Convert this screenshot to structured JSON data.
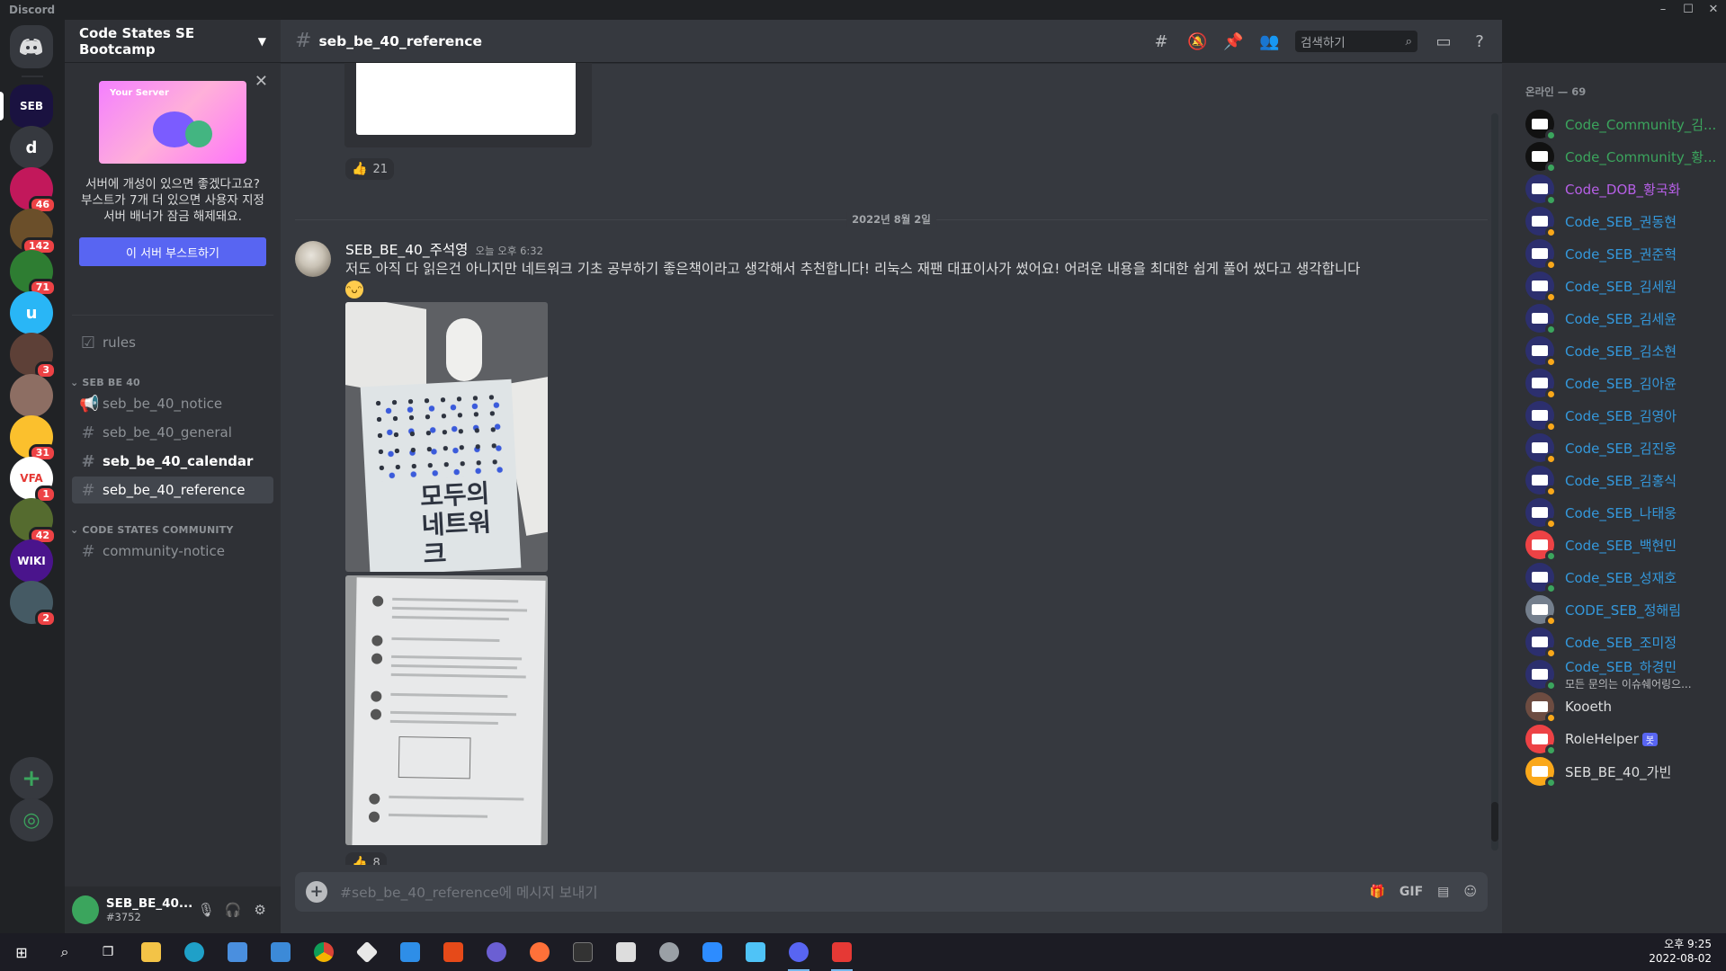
{
  "window": {
    "title": "Discord"
  },
  "rail": {
    "servers": [
      {
        "label": "SEB",
        "bg": "#1a1240",
        "badge": ""
      },
      {
        "label": "d",
        "bg": "#36393f",
        "badge": ""
      },
      {
        "label": "",
        "bg": "#c2185b",
        "badge": "46"
      },
      {
        "label": "",
        "bg": "#6b4f2a",
        "badge": "142"
      },
      {
        "label": "",
        "bg": "#2e7d32",
        "badge": "71"
      },
      {
        "label": "u",
        "bg": "#29b6f6",
        "badge": ""
      },
      {
        "label": "",
        "bg": "#5d4037",
        "badge": "3"
      },
      {
        "label": "",
        "bg": "#8d6e63",
        "badge": ""
      },
      {
        "label": "",
        "bg": "#fbc02d",
        "badge": "31"
      },
      {
        "label": "VFA",
        "bg": "#ffffff",
        "badge": "1"
      },
      {
        "label": "",
        "bg": "#556b2f",
        "badge": "42"
      },
      {
        "label": "WIKI",
        "bg": "#4a148c",
        "badge": ""
      },
      {
        "label": "",
        "bg": "#455a64",
        "badge": "2"
      }
    ]
  },
  "sidebar": {
    "server_name": "Code States SE Bootcamp",
    "boost": {
      "banner_label": "Your Server",
      "text": "서버에 개성이 있으면 좋겠다고요? 부스트가 7개 더 있으면 사용자 지정 서버 배너가 잠금 해제돼요.",
      "button": "이 서버 부스트하기"
    },
    "channels_top": [
      {
        "name": "rules"
      }
    ],
    "categories": [
      {
        "name": "SEB BE 40",
        "channels": [
          {
            "name": "seb_be_40_notice"
          },
          {
            "name": "seb_be_40_general"
          },
          {
            "name": "seb_be_40_calendar"
          },
          {
            "name": "seb_be_40_reference"
          }
        ]
      },
      {
        "name": "CODE STATES COMMUNITY",
        "channels": [
          {
            "name": "community-notice"
          }
        ]
      }
    ],
    "user": {
      "name": "SEB_BE_40...",
      "tag": "#3752"
    }
  },
  "header": {
    "channel": "seb_be_40_reference",
    "search_placeholder": "검색하기"
  },
  "messages": {
    "prev_reaction": {
      "emoji": "👍",
      "count": "21"
    },
    "date_divider": "2022년 8월 2일",
    "author": "SEB_BE_40_주석영",
    "time": "오늘 오후 6:32",
    "text": "저도 아직 다 읽은건 아니지만 네트워크 기초 공부하기 좋은책이라고 생각해서 추천합니다! 리눅스 재팬 대표이사가 썼어요! 어려운 내용을 최대한 쉽게 풀어 썼다고 생각합니다",
    "book_title": "모두의 네트워크",
    "reaction": {
      "emoji": "👍",
      "count": "8"
    }
  },
  "composer": {
    "placeholder": "#seb_be_40_reference에 메시지 보내기",
    "gif": "GIF"
  },
  "members": {
    "heading": "온라인 — 69",
    "list": [
      {
        "name": "Code_Community_김...",
        "color": "#3ba55d",
        "status": "#3ba55d",
        "sub": ""
      },
      {
        "name": "Code_Community_황...",
        "color": "#3ba55d",
        "status": "#3ba55d",
        "sub": ""
      },
      {
        "name": "Code_DOB_황국화",
        "color": "#b65fe6",
        "status": "#3ba55d",
        "sub": ""
      },
      {
        "name": "Code_SEB_권동현",
        "color": "#3498db",
        "status": "#faa81a",
        "sub": ""
      },
      {
        "name": "Code_SEB_권준혁",
        "color": "#3498db",
        "status": "#faa81a",
        "sub": ""
      },
      {
        "name": "Code_SEB_김세원",
        "color": "#3498db",
        "status": "#faa81a",
        "sub": ""
      },
      {
        "name": "Code_SEB_김세윤",
        "color": "#3498db",
        "status": "#3ba55d",
        "sub": ""
      },
      {
        "name": "Code_SEB_김소현",
        "color": "#3498db",
        "status": "#faa81a",
        "sub": ""
      },
      {
        "name": "Code_SEB_김아윤",
        "color": "#3498db",
        "status": "#faa81a",
        "sub": ""
      },
      {
        "name": "Code_SEB_김영아",
        "color": "#3498db",
        "status": "#faa81a",
        "sub": ""
      },
      {
        "name": "Code_SEB_김진웅",
        "color": "#3498db",
        "status": "#faa81a",
        "sub": ""
      },
      {
        "name": "Code_SEB_김홍식",
        "color": "#3498db",
        "status": "#faa81a",
        "sub": ""
      },
      {
        "name": "Code_SEB_나태웅",
        "color": "#3498db",
        "status": "#faa81a",
        "sub": ""
      },
      {
        "name": "Code_SEB_백현민",
        "color": "#3498db",
        "status": "#3ba55d",
        "sub": ""
      },
      {
        "name": "Code_SEB_성재호",
        "color": "#3498db",
        "status": "#3ba55d",
        "sub": ""
      },
      {
        "name": "CODE_SEB_정해림",
        "color": "#3498db",
        "status": "#faa81a",
        "sub": ""
      },
      {
        "name": "Code_SEB_조미정",
        "color": "#3498db",
        "status": "#faa81a",
        "sub": ""
      },
      {
        "name": "Code_SEB_하경민",
        "color": "#3498db",
        "status": "#3ba55d",
        "sub": "모든 문의는 이슈쉐어링으..."
      },
      {
        "name": "Kooeth",
        "color": "#dcddde",
        "status": "#faa81a",
        "sub": ""
      },
      {
        "name": "RoleHelper",
        "color": "#dcddde",
        "status": "#3ba55d",
        "sub": "",
        "bot": "봇"
      },
      {
        "name": "SEB_BE_40_가빈",
        "color": "#dcddde",
        "status": "#3ba55d",
        "sub": ""
      }
    ]
  },
  "taskbar": {
    "time": "오후 9:25",
    "date": "2022-08-02"
  }
}
